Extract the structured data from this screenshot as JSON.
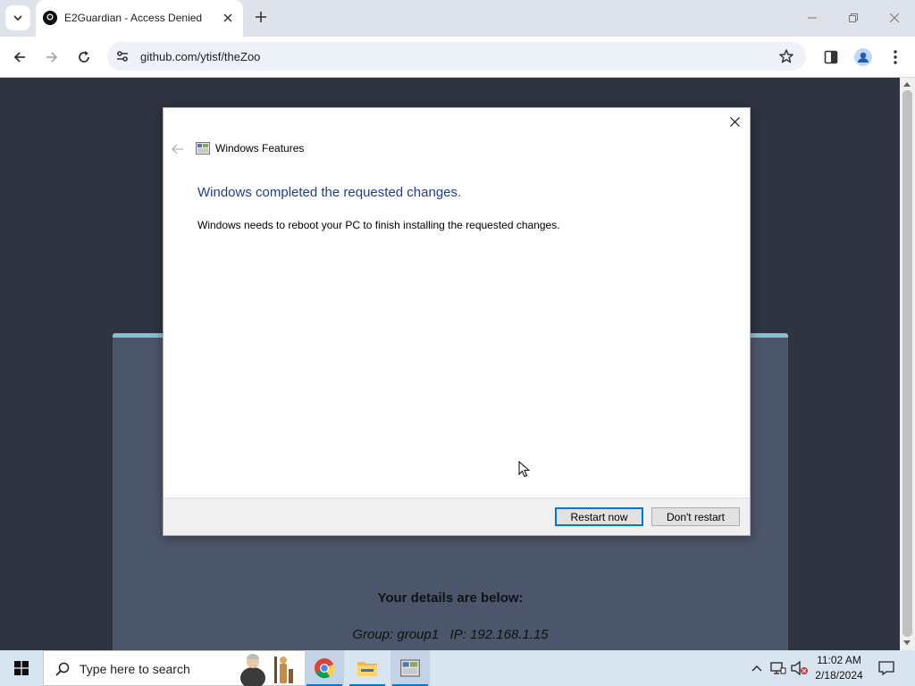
{
  "browser": {
    "tab_title": "E2Guardian - Access Denied",
    "url": "github.com/ytisf/theZoo"
  },
  "page": {
    "details_heading": "Your details are below:",
    "details_line": "Group: group1   IP: 192.168.1.15"
  },
  "dialog": {
    "app_title": "Windows Features",
    "heading": "Windows completed the requested changes.",
    "message": "Windows needs to reboot your PC to finish installing the requested changes.",
    "restart_now_label": "Restart now",
    "dont_restart_label": "Don't restart"
  },
  "taskbar": {
    "search_placeholder": "Type here to search",
    "time": "11:02 AM",
    "date": "2/18/2024",
    "apps": [
      "chrome-icon",
      "file-explorer-icon",
      "windows-features-icon"
    ]
  },
  "colors": {
    "accent": "#0078d7",
    "dialog_heading": "#1e3f8f",
    "page_background": "#2e3440",
    "panel_background": "#4c566a",
    "panel_border": "#88c0d0",
    "taskbar": "#d9e4f1"
  }
}
